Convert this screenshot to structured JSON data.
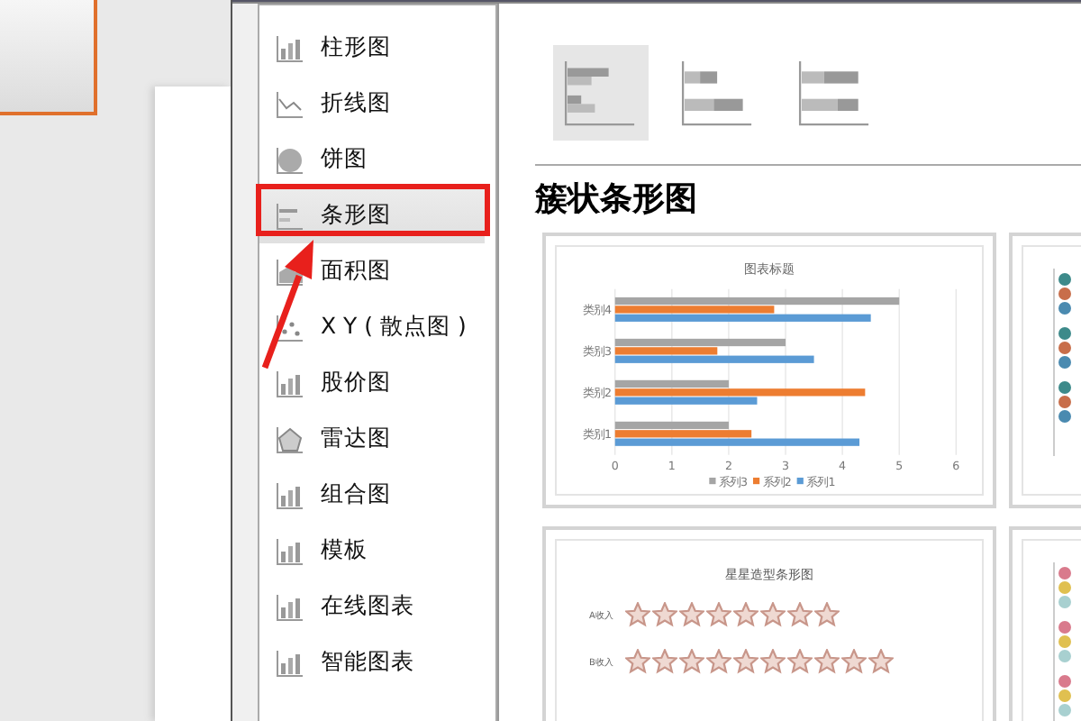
{
  "sidebar": {
    "items": [
      {
        "label": "柱形图",
        "selected": false
      },
      {
        "label": "折线图",
        "selected": false
      },
      {
        "label": "饼图",
        "selected": false
      },
      {
        "label": "条形图",
        "selected": true
      },
      {
        "label": "面积图",
        "selected": false
      },
      {
        "label": "X Y ( 散点图 )",
        "selected": false
      },
      {
        "label": "股价图",
        "selected": false
      },
      {
        "label": "雷达图",
        "selected": false
      },
      {
        "label": "组合图",
        "selected": false
      },
      {
        "label": "模板",
        "selected": false
      },
      {
        "label": "在线图表",
        "selected": false
      },
      {
        "label": "智能图表",
        "selected": false
      }
    ]
  },
  "subtypes": [
    {
      "selected": true
    },
    {
      "selected": false
    },
    {
      "selected": false
    }
  ],
  "heading": "簇状条形图",
  "previews": [
    {
      "kind": "bar",
      "chart_data": {
        "type": "bar",
        "orientation": "horizontal",
        "title": "图表标题",
        "categories": [
          "类别4",
          "类别3",
          "类别2",
          "类别1"
        ],
        "xlim": [
          0,
          6
        ],
        "xticks": [
          0,
          1,
          2,
          3,
          4,
          5,
          6
        ],
        "grid": true,
        "legend": true,
        "series": [
          {
            "name": "系列1",
            "color": "#5b9bd5",
            "values": [
              4.5,
              3.5,
              2.5,
              4.3
            ]
          },
          {
            "name": "系列2",
            "color": "#ed7d31",
            "values": [
              2.8,
              1.8,
              4.4,
              2.4
            ]
          },
          {
            "name": "系列3",
            "color": "#a5a5a5",
            "values": [
              5,
              3,
              2,
              2
            ]
          }
        ]
      }
    },
    {
      "kind": "dots"
    },
    {
      "kind": "stars",
      "title": "星星造型条形图",
      "rows": [
        {
          "label": "A收入",
          "stars": 8
        },
        {
          "label": "B收入",
          "stars": 10
        }
      ]
    },
    {
      "kind": "dots2"
    }
  ]
}
